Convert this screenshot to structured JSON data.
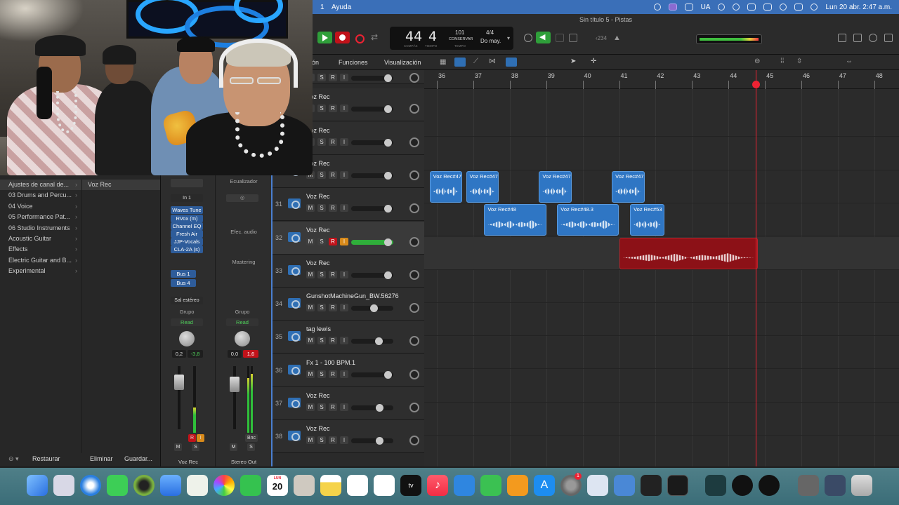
{
  "menubar": {
    "index_label": "1",
    "help": "Ayuda",
    "keyboard_layout": "UA",
    "datetime": "Lun 20 abr.  2:47 a.m."
  },
  "window": {
    "title": "Sin título 5 - Pistas"
  },
  "transport": {
    "bar": "44",
    "beat": "4",
    "bar_caption": "COMPÁS",
    "beat_caption": "TIEMPO",
    "tempo": "101",
    "tempo_mode": "CONSERVAR",
    "tempo_caption": "TEMPO",
    "time_signature": "4/4",
    "key": "Do may.",
    "count_in": "‹234"
  },
  "editor_menu": {
    "edit_partial": "ón",
    "functions": "Funciones",
    "view": "Visualización"
  },
  "ruler": {
    "bars": [
      "36",
      "37",
      "38",
      "39",
      "40",
      "41",
      "42",
      "43",
      "44",
      "45",
      "46",
      "47",
      "48"
    ]
  },
  "library": {
    "categories": [
      "Ajustes de canal de...",
      "03 Drums and Percu...",
      "04 Voice",
      "05 Performance Pat...",
      "06 Studio Instruments",
      "Acoustic Guitar",
      "Effects",
      "Electric Guitar and B...",
      "Experimental"
    ],
    "preset": "Voz Rec",
    "restore": "Restaurar",
    "delete": "Eliminar",
    "save": "Guardar..."
  },
  "mixer": {
    "voz": {
      "eq": "",
      "input": "In 1",
      "plugins": [
        "Waves Tune",
        "RVox (m)",
        "Channel EQ",
        "Fresh Air",
        "JJP-Vocals",
        "CLA-2A (s)"
      ],
      "sends": [
        "Bus 1",
        "Bus 4"
      ],
      "output": "Sal estéreo",
      "group": "Grupo",
      "automation": "Read",
      "volume": "0,2",
      "peak": "-3,8",
      "name": "Voz Rec",
      "r": "R",
      "i": "I",
      "m": "M",
      "s": "S"
    },
    "stereo": {
      "eq": "Ecualizador",
      "audio_fx": "Efec. audio",
      "mastering": "Mastering",
      "group": "Grupo",
      "automation": "Read",
      "volume": "0,0",
      "peak": "1,6",
      "bnc": "Bnc",
      "name": "Stereo Out",
      "m": "M",
      "s": "S"
    }
  },
  "tracks": {
    "header_s": "S",
    "list": [
      {
        "num": "",
        "name": "",
        "vol": 0.88
      },
      {
        "num": "",
        "name": "Voz Rec",
        "vol": 0.88
      },
      {
        "num": "",
        "name": "Voz Rec",
        "vol": 0.88
      },
      {
        "num": "30",
        "name": "Voz Rec",
        "vol": 0.88
      },
      {
        "num": "31",
        "name": "Voz Rec",
        "vol": 0.88
      },
      {
        "num": "32",
        "name": "Voz Rec",
        "vol": 0.88,
        "selected": true,
        "record": true
      },
      {
        "num": "33",
        "name": "Voz Rec",
        "vol": 0.88
      },
      {
        "num": "34",
        "name": "GunshotMachineGun_BW.56276",
        "vol": 0.55
      },
      {
        "num": "35",
        "name": "tag lewis",
        "vol": 0.66
      },
      {
        "num": "36",
        "name": "Fx 1 - 100 BPM.1",
        "vol": 0.88
      },
      {
        "num": "37",
        "name": "Voz Rec",
        "vol": 0.68
      },
      {
        "num": "38",
        "name": "Voz Rec",
        "vol": 0.68
      }
    ]
  },
  "regions": [
    {
      "name": "Voz Rec#47",
      "bar": 35.8,
      "len": 0.9,
      "lane": 3
    },
    {
      "name": "Voz Rec#47",
      "bar": 36.8,
      "len": 0.9,
      "lane": 3
    },
    {
      "name": "Voz Rec#47",
      "bar": 38.8,
      "len": 0.9,
      "lane": 3
    },
    {
      "name": "Voz Rec#47",
      "bar": 40.8,
      "len": 0.9,
      "lane": 3
    },
    {
      "name": "Voz Rec#48",
      "bar": 37.3,
      "len": 1.7,
      "lane": 4
    },
    {
      "name": "Voz Rec#48.3",
      "bar": 39.3,
      "len": 1.7,
      "lane": 4
    },
    {
      "name": "Voz Rec#53",
      "bar": 41.3,
      "len": 0.95,
      "lane": 4
    },
    {
      "name": "",
      "bar": 41.0,
      "len": 3.8,
      "lane": 5,
      "recording": true
    }
  ],
  "playhead_bar": 44.75,
  "dock": {
    "calendar_day": "20",
    "calendar_month": "LUN",
    "badge": "1"
  }
}
